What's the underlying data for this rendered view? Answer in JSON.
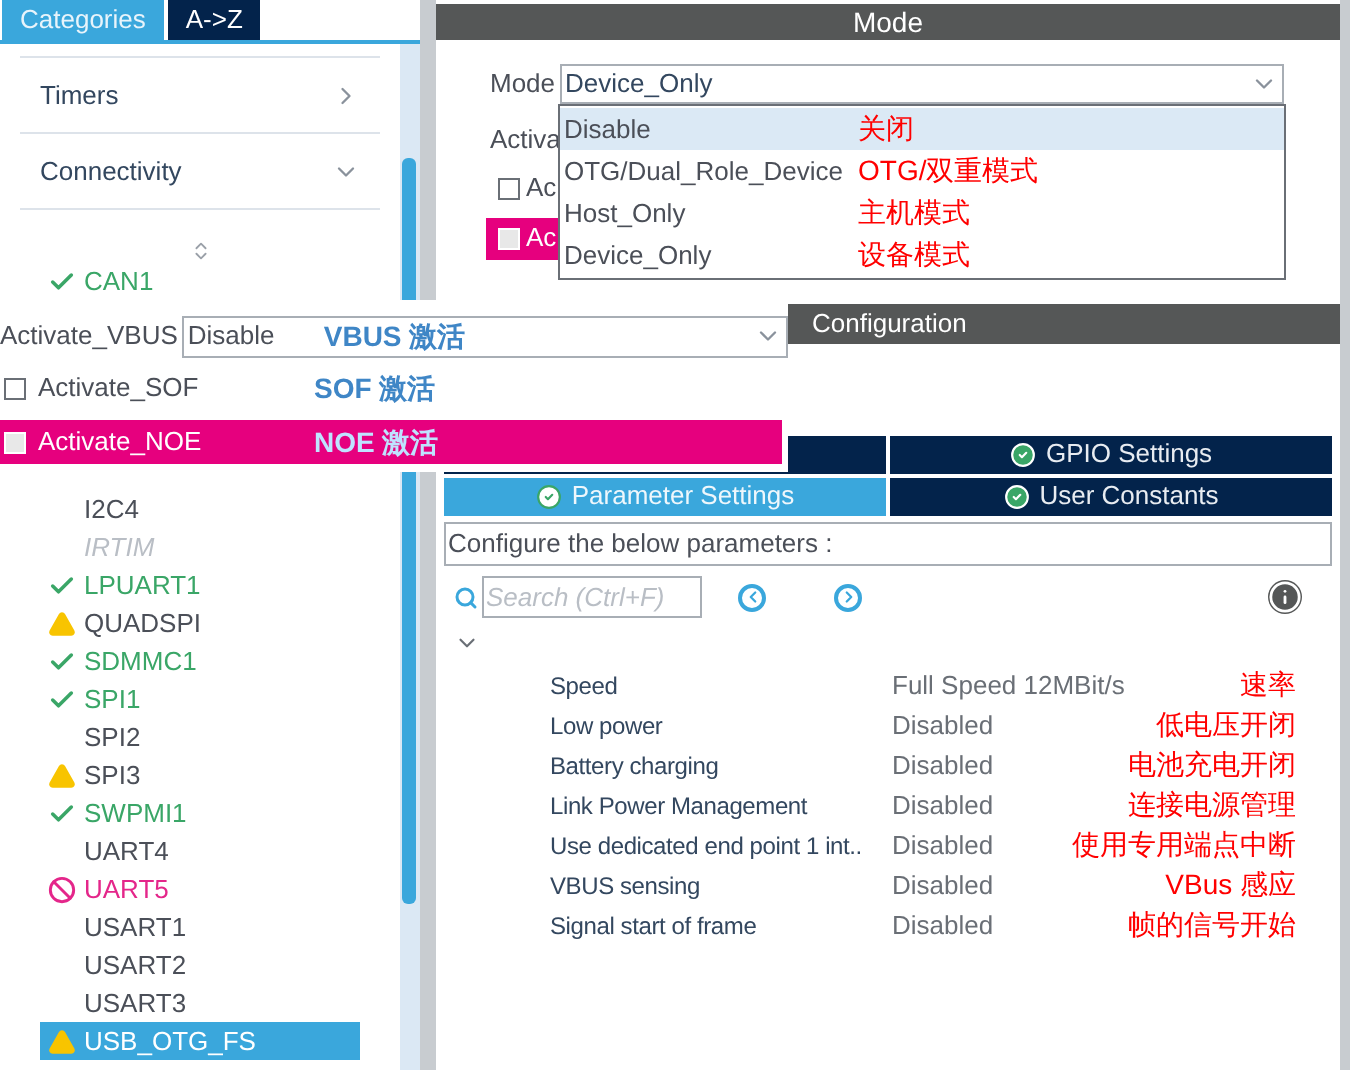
{
  "sidebar": {
    "tabs": [
      {
        "label": "Categories",
        "selected": true
      },
      {
        "label": "A->Z",
        "selected": false
      }
    ],
    "categories": [
      {
        "label": "Timers",
        "expanded": false
      },
      {
        "label": "Connectivity",
        "expanded": true
      }
    ],
    "lead_items": [
      {
        "label": "CAN1",
        "kind": "ok",
        "selected": false
      }
    ],
    "items": [
      {
        "label": "I2C4",
        "kind": "plain",
        "selected": false
      },
      {
        "label": "IRTIM",
        "kind": "unavailable",
        "selected": false
      },
      {
        "label": "LPUART1",
        "kind": "ok",
        "selected": false
      },
      {
        "label": "QUADSPI",
        "kind": "warning",
        "selected": false
      },
      {
        "label": "SDMMC1",
        "kind": "ok",
        "selected": false
      },
      {
        "label": "SPI1",
        "kind": "ok",
        "selected": false
      },
      {
        "label": "SPI2",
        "kind": "plain",
        "selected": false
      },
      {
        "label": "SPI3",
        "kind": "warning",
        "selected": false
      },
      {
        "label": "SWPMI1",
        "kind": "ok",
        "selected": false
      },
      {
        "label": "UART4",
        "kind": "plain",
        "selected": false
      },
      {
        "label": "UART5",
        "kind": "error",
        "selected": false
      },
      {
        "label": "USART1",
        "kind": "plain",
        "selected": false
      },
      {
        "label": "USART2",
        "kind": "plain",
        "selected": false
      },
      {
        "label": "USART3",
        "kind": "plain",
        "selected": false
      },
      {
        "label": "USB_OTG_FS",
        "kind": "warning",
        "selected": true
      }
    ]
  },
  "mode": {
    "title": "Mode",
    "field_label": "Mode",
    "value": "Device_Only",
    "partial_label": "Activa",
    "partial_checks": [
      {
        "label": "Ac",
        "checked": false,
        "selected": false
      },
      {
        "label": "Ac",
        "checked": false,
        "selected": true
      }
    ],
    "options": [
      {
        "label": "Disable",
        "note": "关闭",
        "highlighted": true
      },
      {
        "label": "OTG/Dual_Role_Device",
        "note": "OTG/双重模式",
        "highlighted": false
      },
      {
        "label": "Host_Only",
        "note": "主机模式",
        "highlighted": false
      },
      {
        "label": "Device_Only",
        "note": "设备模式",
        "highlighted": false
      }
    ]
  },
  "popup": {
    "vbus_label": "Activate_VBUS",
    "vbus_value": "Disable",
    "vbus_note": "VBUS 激活",
    "checks": [
      {
        "label": "Activate_SOF",
        "note": "SOF 激活",
        "checked": false,
        "selected": false
      },
      {
        "label": "Activate_NOE",
        "note": "NOE 激活",
        "checked": false,
        "selected": true
      }
    ]
  },
  "configuration": {
    "title": "Configuration",
    "tabs": [
      {
        "label": "GPIO Settings",
        "selected": false
      },
      {
        "label": "Parameter Settings",
        "selected": true
      },
      {
        "label": "User Constants",
        "selected": false
      }
    ],
    "hint": "Configure the below parameters :",
    "search_placeholder": "Search (Ctrl+F)",
    "parameters": [
      {
        "name": "Speed",
        "value": "Full Speed 12MBit/s",
        "note": "速率"
      },
      {
        "name": "Low power",
        "value": "Disabled",
        "note": "低电压开闭"
      },
      {
        "name": "Battery charging",
        "value": "Disabled",
        "note": "电池充电开闭"
      },
      {
        "name": "Link Power Management",
        "value": "Disabled",
        "note": "连接电源管理"
      },
      {
        "name": "Use dedicated end point 1 int..",
        "value": "Disabled",
        "note": "使用专用端点中断"
      },
      {
        "name": "VBUS sensing",
        "value": "Disabled",
        "note": "VBus 感应"
      },
      {
        "name": "Signal start of frame",
        "value": "Disabled",
        "note": "帧的信号开始"
      }
    ]
  }
}
